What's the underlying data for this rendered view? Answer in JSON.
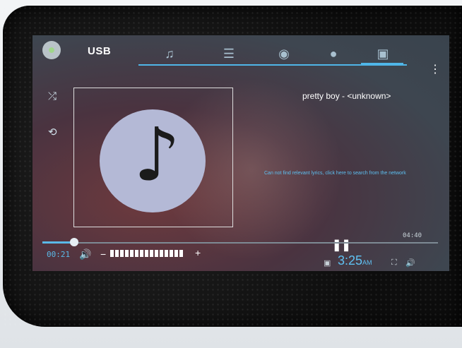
{
  "player": {
    "source": "USB",
    "song_title": "pretty boy",
    "song_separator": " - ",
    "song_artist": "<unknown>",
    "lyrics_message": "Can not find relevant lyrics, click here to search from the network",
    "elapsed": "00:21",
    "total": "04:40",
    "progress_fraction": 0.08,
    "volume_steps_total": 15,
    "volume_minus": "−",
    "volume_plus": "+"
  },
  "tabs": [
    {
      "icon": "music-note-icon",
      "glyph": "♫"
    },
    {
      "icon": "playlist-icon",
      "glyph": "☰"
    },
    {
      "icon": "disc-icon",
      "glyph": "◉"
    },
    {
      "icon": "artist-icon",
      "glyph": "👤"
    },
    {
      "icon": "now-playing-icon",
      "glyph": "▶"
    }
  ],
  "status": {
    "clock_time": "3:25",
    "clock_ampm": "AM"
  },
  "colors": {
    "accent": "#4fb6e8"
  }
}
